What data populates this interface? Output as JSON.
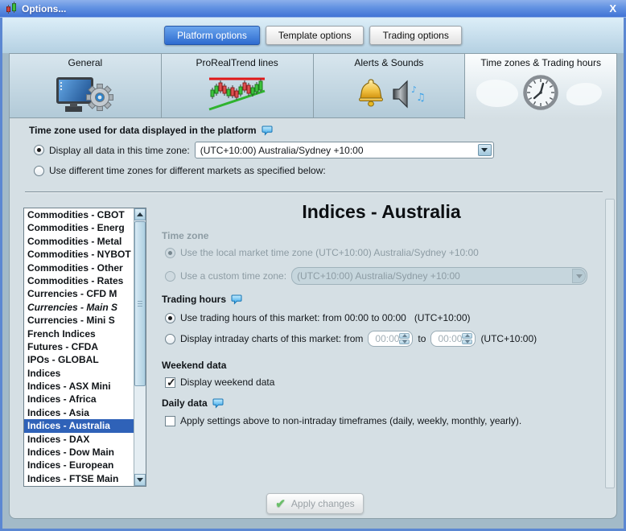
{
  "window": {
    "title": "Options...",
    "close": "X"
  },
  "top_tabs": [
    {
      "label": "Platform options",
      "selected": true
    },
    {
      "label": "Template options",
      "selected": false
    },
    {
      "label": "Trading options",
      "selected": false
    }
  ],
  "category_tabs": [
    {
      "label": "General",
      "icon": "monitor-gear-icon",
      "selected": false
    },
    {
      "label": "ProRealTrend lines",
      "icon": "trend-chart-icon",
      "selected": false
    },
    {
      "label": "Alerts & Sounds",
      "icon": "bell-speaker-icon",
      "selected": false
    },
    {
      "label": "Time zones & Trading hours",
      "icon": "world-clock-icon",
      "selected": true
    }
  ],
  "platform_timezone": {
    "heading": "Time zone used for data displayed in the platform",
    "option_all": "Display all data in this time zone:",
    "all_value": "(UTC+10:00) Australia/Sydney +10:00",
    "option_per_market": "Use different time zones for different markets as specified below:"
  },
  "markets": {
    "items": [
      {
        "label": "Commodities - CBOT"
      },
      {
        "label": "Commodities - Energ"
      },
      {
        "label": "Commodities - Metal"
      },
      {
        "label": "Commodities - NYBOT"
      },
      {
        "label": "Commodities - Other"
      },
      {
        "label": "Commodities - Rates"
      },
      {
        "label": "Currencies - CFD M"
      },
      {
        "label": "Currencies - Main S",
        "italic": true
      },
      {
        "label": "Currencies - Mini S"
      },
      {
        "label": "French Indices"
      },
      {
        "label": "Futures - CFDA"
      },
      {
        "label": "IPOs - GLOBAL"
      },
      {
        "label": "Indices"
      },
      {
        "label": "Indices - ASX Mini"
      },
      {
        "label": "Indices - Africa"
      },
      {
        "label": "Indices - Asia"
      },
      {
        "label": "Indices - Australia",
        "selected": true
      },
      {
        "label": "Indices - DAX"
      },
      {
        "label": "Indices - Dow Main"
      },
      {
        "label": "Indices - European"
      },
      {
        "label": "Indices - FTSE Main"
      }
    ]
  },
  "detail": {
    "title": "Indices - Australia",
    "timezone_section": {
      "heading": "Time zone",
      "local_option": "Use the local market time zone (UTC+10:00) Australia/Sydney +10:00",
      "custom_option": "Use a custom time zone:",
      "custom_value": "(UTC+10:00) Australia/Sydney +10:00"
    },
    "trading_hours": {
      "heading": "Trading hours",
      "use_market_option": "Use trading hours of this market: from 00:00 to 00:00",
      "use_market_tz": "(UTC+10:00)",
      "intraday_option": "Display intraday charts of this market:  from",
      "intraday_to": "to",
      "intraday_tz": "(UTC+10:00)",
      "from_time": "00:00",
      "to_time": "00:00"
    },
    "weekend": {
      "heading": "Weekend data",
      "checkbox": "Display weekend data",
      "checked": true
    },
    "daily": {
      "heading": "Daily data",
      "checkbox": "Apply settings above to non-intraday timeframes (daily, weekly, monthly, yearly).",
      "checked": false
    }
  },
  "footer": {
    "apply_label": "Apply changes"
  },
  "colors": {
    "titlebar_blue": "#4374d6",
    "selected_tab_blue": "#2e6bd0",
    "list_selection_blue": "#2f62b8",
    "content_bg": "#d5dfe4",
    "disabled_text": "#8d9ca4",
    "apply_check_green": "#6abf69"
  }
}
